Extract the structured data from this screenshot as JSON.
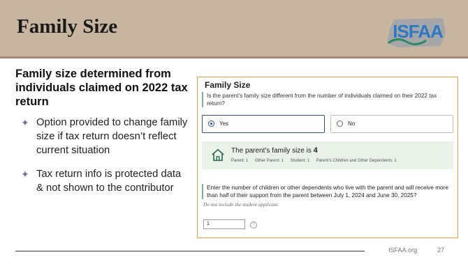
{
  "slide": {
    "title": "Family Size",
    "logo_text": "ISFAA",
    "lead": "Family size determined from individuals claimed on 2022 tax return",
    "bullets": [
      "Option provided to change family size if tax return doesn’t reflect current situation",
      "Tax return info is protected data & not shown to the contributor"
    ],
    "footer_site": "ISFAA.org",
    "footer_page": "27"
  },
  "panel": {
    "title": "Family Size",
    "question": "Is the parent’s family size different from the number of individuals claimed on their 2022 tax return?",
    "options": [
      {
        "label": "Yes",
        "selected": true
      },
      {
        "label": "No",
        "selected": false
      }
    ],
    "summary": {
      "text": "The parent’s family size is",
      "value": "4",
      "breakdown": [
        "Parent: 1",
        "Other Parent: 1",
        "Student: 1",
        "Parent’s Children and Other Dependents: 1"
      ]
    },
    "question2": "Enter the number of children or other dependents who live with the parent and will receive more than half of their support from the parent between July 1, 2024 and June 30, 2025?",
    "note": "Do not include the student applicant.",
    "input_value": "1",
    "colors": {
      "border": "#e89c3a",
      "selected_border": "#2b4f8f",
      "summary_bg": "#e9f1e9",
      "accent_bar": "#7bb58d",
      "header_bg": "#c7b59f"
    },
    "icons": [
      "house-icon",
      "help-icon",
      "radio-selected",
      "radio-unselected",
      "bullet-star-icon"
    ]
  }
}
